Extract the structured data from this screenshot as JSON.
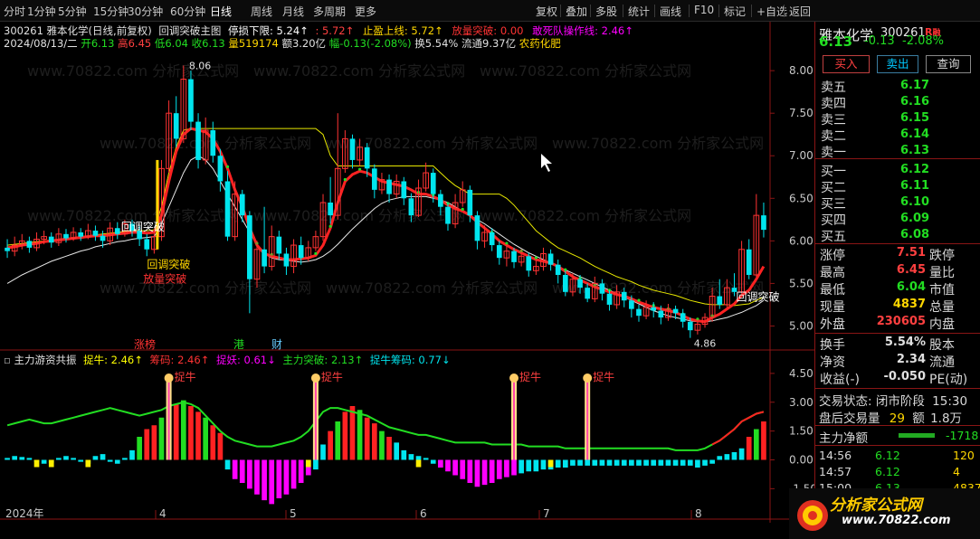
{
  "toolbar": {
    "left_tabs": [
      "分时",
      "1分钟",
      "5分钟",
      "15分钟",
      "30分钟",
      "60分钟",
      "日线",
      "周线",
      "月线",
      "多周期",
      "更多"
    ],
    "active_tab": "日线",
    "right_tools": [
      "复权",
      "叠加",
      "多股",
      "统计",
      "画线",
      "F10",
      "标记",
      "+自选",
      "返回"
    ]
  },
  "main_chart": {
    "stock_line": "300261 雅本化学(日线,前复权)",
    "formula_name": "回调突破主图",
    "stop_loss_label": "停损下限: 5.24↑",
    "val1": ": 5.72↑",
    "stop_profit_label": "止盈上线: 5.72↑",
    "volume_break_label": "放量突破: 0.00",
    "dare_label": "敢死队操作线: 2.46↑",
    "date": "2024/08/13/二",
    "open": "开6.13",
    "high": "高6.45",
    "low": "低6.04",
    "close": "收6.13",
    "vol": "量519174",
    "amount": "额3.20亿",
    "change": "幅-0.13(-2.08%)",
    "turnover": "换5.54%",
    "float_cap": "流通9.37亿",
    "industry": "农药化肥",
    "y_ticks": [
      "8.00",
      "7.50",
      "7.00",
      "6.50",
      "6.00",
      "5.50",
      "5.00"
    ],
    "high_mark": "8.06",
    "low_mark": "4.86",
    "annotations": [
      "回调突破",
      "放量突破",
      "回调突破",
      "回调突破"
    ],
    "bottom_tags": [
      "涨榜",
      "港",
      "财"
    ]
  },
  "indicator": {
    "name": "主力游资共振",
    "catch_bull": "捉牛: 2.46↑",
    "chips": "筹码: 2.46↑",
    "catch_demon": "捉妖: 0.61↓",
    "main_break": "主力突破: 2.13↑",
    "catch_chips": "捉牛筹码: 0.77↓",
    "y_ticks": [
      "4.50",
      "3.00",
      "1.50",
      "0.00",
      "-1.50"
    ],
    "signal_label": "捉牛"
  },
  "x_axis": {
    "labels": [
      "2024年",
      "4",
      "5",
      "6",
      "7",
      "8"
    ]
  },
  "chart_data": {
    "type": "candlestick",
    "ylim": [
      4.75,
      8.15
    ],
    "candles": [
      [
        5.92,
        5.88,
        6.02,
        5.8
      ],
      [
        5.88,
        5.95,
        6.05,
        5.82
      ],
      [
        5.95,
        6.0,
        6.08,
        5.9
      ],
      [
        6.0,
        5.92,
        6.05,
        5.86
      ],
      [
        5.92,
        6.02,
        6.1,
        5.88
      ],
      [
        6.02,
        6.05,
        6.12,
        5.96
      ],
      [
        6.05,
        5.98,
        6.1,
        5.92
      ],
      [
        5.98,
        6.08,
        6.15,
        5.94
      ],
      [
        6.08,
        6.03,
        6.14,
        5.98
      ],
      [
        6.03,
        6.1,
        6.16,
        6.0
      ],
      [
        6.1,
        6.05,
        6.15,
        6.0
      ],
      [
        6.05,
        6.12,
        6.2,
        6.02
      ],
      [
        6.12,
        6.06,
        6.18,
        6.0
      ],
      [
        6.06,
        6.0,
        6.12,
        5.92
      ],
      [
        6.0,
        6.15,
        6.22,
        5.95
      ],
      [
        6.15,
        6.08,
        6.22,
        6.02
      ],
      [
        6.08,
        6.2,
        6.25,
        6.05
      ],
      [
        6.2,
        6.12,
        6.25,
        6.05
      ],
      [
        6.12,
        6.02,
        6.18,
        5.94
      ],
      [
        6.02,
        5.9,
        6.08,
        5.82
      ],
      [
        5.9,
        6.05,
        6.12,
        5.85
      ],
      [
        6.05,
        6.85,
        6.95,
        6.0
      ],
      [
        6.85,
        7.5,
        7.65,
        6.8
      ],
      [
        7.5,
        7.2,
        7.7,
        7.1
      ],
      [
        7.2,
        7.9,
        8.06,
        7.15
      ],
      [
        7.9,
        7.4,
        8.0,
        7.3
      ],
      [
        7.4,
        6.95,
        7.5,
        6.85
      ],
      [
        6.95,
        7.3,
        7.45,
        6.9
      ],
      [
        7.3,
        7.0,
        7.4,
        6.92
      ],
      [
        7.0,
        6.7,
        7.08,
        6.58
      ],
      [
        6.7,
        6.05,
        6.82,
        6.0
      ],
      [
        6.05,
        6.55,
        6.7,
        6.0
      ],
      [
        6.55,
        6.3,
        6.6,
        6.22
      ],
      [
        6.3,
        5.55,
        6.35,
        5.15
      ],
      [
        5.55,
        5.9,
        6.0,
        5.45
      ],
      [
        5.9,
        5.7,
        6.4,
        5.62
      ],
      [
        5.7,
        6.05,
        6.18,
        5.65
      ],
      [
        6.05,
        5.85,
        6.12,
        5.78
      ],
      [
        5.85,
        5.7,
        5.92,
        5.6
      ],
      [
        5.7,
        5.95,
        6.02,
        5.62
      ],
      [
        5.95,
        5.8,
        6.05,
        5.72
      ],
      [
        5.8,
        5.92,
        6.0,
        5.76
      ],
      [
        5.92,
        6.05,
        6.12,
        5.88
      ],
      [
        6.05,
        6.45,
        6.55,
        6.0
      ],
      [
        6.45,
        6.3,
        6.75,
        6.2
      ],
      [
        6.3,
        6.85,
        7.5,
        6.25
      ],
      [
        6.85,
        7.2,
        7.3,
        6.8
      ],
      [
        7.2,
        6.95,
        7.25,
        6.85
      ],
      [
        6.95,
        7.1,
        7.2,
        6.88
      ],
      [
        7.1,
        6.85,
        7.15,
        6.75
      ],
      [
        6.85,
        6.6,
        6.9,
        6.5
      ],
      [
        6.6,
        6.72,
        6.8,
        6.55
      ],
      [
        6.72,
        6.55,
        6.78,
        6.45
      ],
      [
        6.55,
        6.7,
        6.78,
        6.5
      ],
      [
        6.7,
        6.5,
        6.75,
        6.42
      ],
      [
        6.5,
        6.3,
        6.56,
        6.22
      ],
      [
        6.3,
        6.62,
        6.72,
        6.28
      ],
      [
        6.62,
        6.8,
        6.92,
        6.58
      ],
      [
        6.8,
        6.55,
        6.85,
        6.45
      ],
      [
        6.55,
        6.4,
        6.6,
        6.3
      ],
      [
        6.4,
        6.2,
        6.45,
        6.12
      ],
      [
        6.2,
        6.45,
        6.55,
        6.15
      ],
      [
        6.45,
        6.6,
        6.7,
        6.4
      ],
      [
        6.6,
        6.3,
        6.65,
        6.22
      ],
      [
        6.3,
        6.0,
        6.35,
        5.9
      ],
      [
        6.0,
        6.1,
        6.18,
        5.92
      ],
      [
        6.1,
        5.95,
        6.15,
        5.88
      ],
      [
        5.95,
        5.8,
        6.0,
        5.72
      ],
      [
        5.8,
        5.88,
        5.96,
        5.7
      ],
      [
        5.88,
        5.75,
        5.92,
        5.68
      ],
      [
        5.75,
        5.82,
        5.9,
        5.7
      ],
      [
        5.82,
        5.65,
        5.86,
        5.58
      ],
      [
        5.65,
        5.7,
        5.78,
        5.6
      ],
      [
        5.7,
        5.85,
        5.92,
        5.65
      ],
      [
        5.85,
        5.72,
        5.9,
        5.65
      ],
      [
        5.72,
        5.6,
        5.78,
        5.5
      ],
      [
        5.6,
        5.4,
        5.65,
        5.35
      ],
      [
        5.4,
        5.55,
        5.62,
        5.35
      ],
      [
        5.55,
        5.45,
        5.6,
        5.38
      ],
      [
        5.45,
        5.32,
        5.5,
        5.28
      ],
      [
        5.32,
        5.5,
        5.58,
        5.28
      ],
      [
        5.5,
        5.38,
        5.55,
        5.3
      ],
      [
        5.38,
        5.25,
        5.42,
        5.18
      ],
      [
        5.25,
        5.4,
        5.48,
        5.2
      ],
      [
        5.4,
        5.3,
        5.45,
        5.22
      ],
      [
        5.3,
        5.2,
        5.36,
        5.1
      ],
      [
        5.2,
        5.12,
        5.25,
        5.05
      ],
      [
        5.12,
        5.22,
        5.3,
        5.08
      ],
      [
        5.22,
        5.18,
        5.28,
        5.1
      ],
      [
        5.18,
        5.1,
        5.24,
        5.02
      ],
      [
        5.1,
        5.2,
        5.26,
        5.06
      ],
      [
        5.2,
        5.15,
        5.24,
        5.08
      ],
      [
        5.15,
        5.05,
        5.2,
        4.98
      ],
      [
        5.05,
        4.95,
        5.1,
        4.86
      ],
      [
        4.95,
        5.02,
        5.08,
        4.9
      ],
      [
        5.02,
        5.1,
        5.15,
        4.98
      ],
      [
        5.1,
        5.35,
        5.45,
        5.05
      ],
      [
        5.35,
        5.25,
        5.55,
        5.2
      ],
      [
        5.25,
        5.45,
        5.55,
        5.22
      ],
      [
        5.45,
        5.4,
        5.62,
        5.35
      ],
      [
        5.4,
        5.9,
        6.0,
        5.38
      ],
      [
        5.9,
        5.6,
        6.02,
        5.55
      ],
      [
        5.6,
        6.3,
        6.55,
        5.58
      ],
      [
        6.3,
        6.13,
        6.45,
        6.04
      ]
    ],
    "ma_red": [
      5.92,
      5.93,
      5.95,
      5.96,
      5.97,
      5.99,
      6.0,
      6.01,
      6.02,
      6.03,
      6.04,
      6.05,
      6.06,
      6.06,
      6.07,
      6.08,
      6.09,
      6.1,
      6.1,
      6.09,
      6.1,
      6.3,
      6.7,
      7.05,
      7.25,
      7.32,
      7.3,
      7.28,
      7.2,
      7.05,
      6.85,
      6.6,
      6.4,
      6.15,
      5.95,
      5.85,
      5.82,
      5.8,
      5.78,
      5.78,
      5.79,
      5.8,
      5.83,
      5.95,
      6.15,
      6.45,
      6.7,
      6.78,
      6.82,
      6.8,
      6.75,
      6.7,
      6.68,
      6.66,
      6.64,
      6.6,
      6.55,
      6.55,
      6.52,
      6.48,
      6.42,
      6.38,
      6.35,
      6.3,
      6.22,
      6.15,
      6.08,
      6.0,
      5.95,
      5.9,
      5.86,
      5.82,
      5.78,
      5.76,
      5.74,
      5.7,
      5.64,
      5.58,
      5.54,
      5.5,
      5.46,
      5.43,
      5.4,
      5.37,
      5.35,
      5.32,
      5.28,
      5.25,
      5.22,
      5.2,
      5.18,
      5.16,
      5.12,
      5.08,
      5.06,
      5.05,
      5.1,
      5.14,
      5.2,
      5.26,
      5.36,
      5.42,
      5.55,
      5.7
    ],
    "ma_yellow": [
      5.95,
      5.96,
      5.97,
      5.98,
      5.99,
      6.0,
      6.01,
      6.02,
      6.03,
      6.04,
      6.05,
      6.06,
      6.07,
      6.08,
      6.09,
      6.1,
      6.11,
      6.12,
      6.12,
      6.12,
      6.13,
      6.4,
      6.8,
      7.1,
      7.3,
      7.32,
      7.32,
      7.32,
      7.32,
      7.32,
      7.32,
      7.32,
      7.32,
      7.32,
      7.32,
      7.32,
      7.32,
      7.32,
      7.32,
      7.32,
      7.32,
      7.32,
      7.32,
      7.25,
      7.0,
      6.88,
      6.88,
      6.88,
      6.88,
      6.88,
      6.88,
      6.88,
      6.88,
      6.88,
      6.88,
      6.88,
      6.88,
      6.88,
      6.88,
      6.8,
      6.72,
      6.65,
      6.6,
      6.55,
      6.55,
      6.55,
      6.55,
      6.55,
      6.5,
      6.42,
      6.32,
      6.22,
      6.12,
      6.05,
      5.98,
      5.92,
      5.88,
      5.84,
      5.8,
      5.75,
      5.7,
      5.66,
      5.62,
      5.58,
      5.55,
      5.52,
      5.48,
      5.45,
      5.42,
      5.4,
      5.38,
      5.36,
      5.33,
      5.3,
      5.28,
      5.26,
      5.25,
      5.25,
      5.25,
      5.24,
      5.25,
      5.26,
      5.3,
      5.34
    ],
    "ma_white": [
      5.5,
      5.55,
      5.6,
      5.64,
      5.68,
      5.72,
      5.76,
      5.79,
      5.82,
      5.85,
      5.88,
      5.9,
      5.93,
      5.95,
      5.97,
      5.99,
      6.0,
      6.02,
      6.03,
      6.04,
      6.05,
      6.2,
      6.4,
      6.6,
      6.8,
      6.95,
      7.0,
      6.95,
      6.85,
      6.7,
      6.55,
      6.4,
      6.25,
      6.1,
      5.95,
      5.85,
      5.8,
      5.78,
      5.77,
      5.76,
      5.75,
      5.76,
      5.78,
      5.82,
      5.88,
      5.96,
      6.05,
      6.14,
      6.22,
      6.3,
      6.38,
      6.44,
      6.48,
      6.5,
      6.52,
      6.52,
      6.52,
      6.52,
      6.5,
      6.48,
      6.45,
      6.4,
      6.35,
      6.3,
      6.25,
      6.2,
      6.14,
      6.08,
      6.02,
      5.96,
      5.91,
      5.86,
      5.82,
      5.78,
      5.74,
      5.7,
      5.66,
      5.62,
      5.58,
      5.54,
      5.5,
      5.46,
      5.42,
      5.38,
      5.34,
      5.3,
      5.26,
      5.22,
      5.18,
      5.15,
      5.12,
      5.1,
      5.08,
      5.06,
      5.05,
      5.05,
      5.06,
      5.08,
      5.1,
      5.13,
      5.16,
      5.2,
      5.24,
      5.3
    ],
    "indicator_bars": [
      0.1,
      0.2,
      0.15,
      0.1,
      -0.1,
      -0.2,
      -0.15,
      0.1,
      0.2,
      0.1,
      -0.1,
      -0.2,
      0.2,
      0.3,
      -0.1,
      -0.2,
      0.1,
      0.5,
      1.2,
      1.6,
      1.8,
      2.2,
      2.6,
      2.9,
      3.1,
      2.8,
      2.5,
      2.2,
      1.8,
      1.4,
      -0.5,
      -1.0,
      -1.2,
      -1.5,
      -1.8,
      -2.1,
      -2.3,
      -2.0,
      -1.8,
      -1.5,
      -1.2,
      -0.8,
      -0.5,
      0.8,
      1.5,
      2.0,
      2.5,
      2.8,
      2.6,
      2.2,
      1.9,
      1.5,
      1.2,
      0.9,
      0.5,
      0.3,
      0.2,
      0.1,
      -0.2,
      -0.4,
      -0.6,
      -0.8,
      -1.0,
      -1.2,
      -1.4,
      -1.3,
      -1.2,
      -1.0,
      -0.9,
      -0.8,
      -0.7,
      -0.6,
      -0.6,
      -0.5,
      -0.5,
      -0.4,
      -0.4,
      -0.3,
      -0.3,
      -0.3,
      -0.3,
      -0.3,
      -0.3,
      -0.3,
      -0.3,
      -0.3,
      -0.3,
      -0.3,
      -0.3,
      -0.3,
      -0.3,
      -0.3,
      -0.3,
      -0.3,
      -0.4,
      -0.3,
      -0.2,
      0.2,
      0.3,
      0.4,
      0.6,
      1.2,
      1.6,
      2.0
    ],
    "indicator_line": [
      1.8,
      1.9,
      2.0,
      2.1,
      2.0,
      1.9,
      1.9,
      2.0,
      2.1,
      2.2,
      2.3,
      2.4,
      2.5,
      2.6,
      2.7,
      2.6,
      2.5,
      2.4,
      2.3,
      2.4,
      2.5,
      2.6,
      2.8,
      2.9,
      3.0,
      2.9,
      2.7,
      2.3,
      1.9,
      1.5,
      1.2,
      1.0,
      0.9,
      0.8,
      0.7,
      0.7,
      0.7,
      0.8,
      0.9,
      1.0,
      1.2,
      1.5,
      2.0,
      2.5,
      2.7,
      2.7,
      2.6,
      2.5,
      2.4,
      2.3,
      2.1,
      1.9,
      1.7,
      1.6,
      1.5,
      1.4,
      1.3,
      1.3,
      1.2,
      1.1,
      1.0,
      0.9,
      0.9,
      0.9,
      0.9,
      0.9,
      0.8,
      0.8,
      0.8,
      0.8,
      0.8,
      0.7,
      0.7,
      0.7,
      0.7,
      0.7,
      0.6,
      0.6,
      0.6,
      0.6,
      0.6,
      0.6,
      0.6,
      0.6,
      0.6,
      0.6,
      0.6,
      0.6,
      0.6,
      0.6,
      0.6,
      0.5,
      0.5,
      0.5,
      0.5,
      0.6,
      0.8,
      1.0,
      1.3,
      1.6,
      2.0,
      2.2,
      2.4,
      2.5
    ],
    "signals_index": [
      22,
      42,
      69,
      79
    ],
    "ind_ylim": [
      -2.8,
      5.2
    ]
  },
  "quote": {
    "name": "雅本化学",
    "code": "300261",
    "badge": "R",
    "tag_margin": "融",
    "price": "6.13",
    "change": "-0.13",
    "pct": "-2.08%",
    "buy_btn": "买入",
    "sell_btn": "卖出",
    "query_btn": "查询",
    "asks": [
      [
        "卖五",
        "6.17"
      ],
      [
        "卖四",
        "6.16"
      ],
      [
        "卖三",
        "6.15"
      ],
      [
        "卖二",
        "6.14"
      ],
      [
        "卖一",
        "6.13"
      ]
    ],
    "bids": [
      [
        "买一",
        "6.12"
      ],
      [
        "买二",
        "6.11"
      ],
      [
        "买三",
        "6.10"
      ],
      [
        "买四",
        "6.09"
      ],
      [
        "买五",
        "6.08"
      ]
    ],
    "stats": [
      [
        "涨停",
        "7.51",
        "跌停"
      ],
      [
        "最高",
        "6.45",
        "量比"
      ],
      [
        "最低",
        "6.04",
        "市值"
      ],
      [
        "现量",
        "4837",
        "总量"
      ],
      [
        "外盘",
        "230605",
        "内盘"
      ]
    ],
    "stats2": [
      [
        "换手",
        "5.54%",
        "股本"
      ],
      [
        "净资",
        "2.34",
        "流通"
      ],
      [
        "收益(-)",
        "-0.050",
        "PE(动)"
      ]
    ],
    "trade_status_label": "交易状态:",
    "trade_status_value": "闭市阶段",
    "trade_status_time": "15:30",
    "after_vol_label": "盘后交易量",
    "after_vol_value": "29",
    "after_amt_label": "额",
    "after_amt_value": "1.8万",
    "net_flow_label": "主力净额",
    "net_flow_value": "-1718",
    "ticks": [
      [
        "14:56",
        "6.12",
        "120"
      ],
      [
        "14:57",
        "6.12",
        "4"
      ],
      [
        "15:00",
        "6.13",
        "4837"
      ]
    ]
  },
  "watermark": {
    "text": "www.70822.com 分析家公式网",
    "badge_title": "分析家公式网",
    "badge_url": "www.70822.com"
  },
  "colors": {
    "up": "#ff3333",
    "down": "#00e5ee",
    "yellow": "#ffd700",
    "green": "#22dd22",
    "magenta": "#ff00ff"
  }
}
